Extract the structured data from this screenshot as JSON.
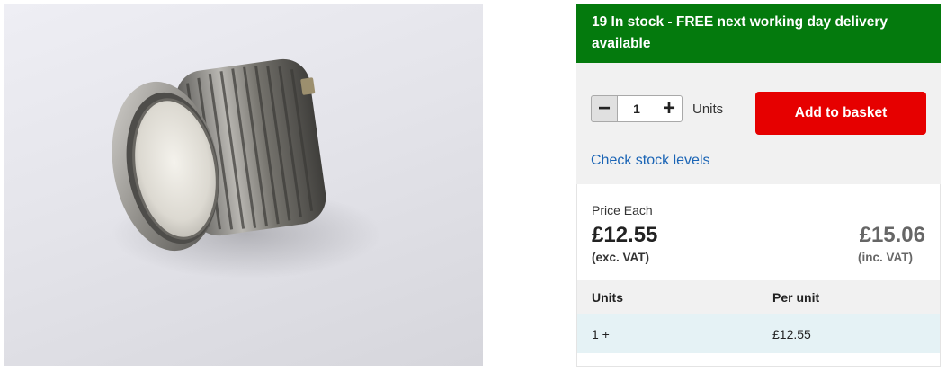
{
  "product_image": {
    "alt_icon": "push-button-switch-photo"
  },
  "stock": {
    "banner_text": "19 In stock - FREE next working day delivery available"
  },
  "basket": {
    "quantity": "1",
    "minus_glyph": "−",
    "plus_glyph": "+",
    "units_label": "Units",
    "add_label": "Add to basket",
    "check_stock_label": "Check stock levels"
  },
  "price": {
    "heading": "Price Each",
    "excl_value": "£12.55",
    "excl_label": "(exc. VAT)",
    "incl_value": "£15.06",
    "incl_label": "(inc. VAT)"
  },
  "tiers": {
    "headers": [
      "Units",
      "Per unit"
    ],
    "rows": [
      [
        "1 +",
        "£12.55"
      ]
    ]
  },
  "colors": {
    "stock_banner": "#047a0d",
    "add_button": "#e60000",
    "link": "#1a64b5"
  }
}
